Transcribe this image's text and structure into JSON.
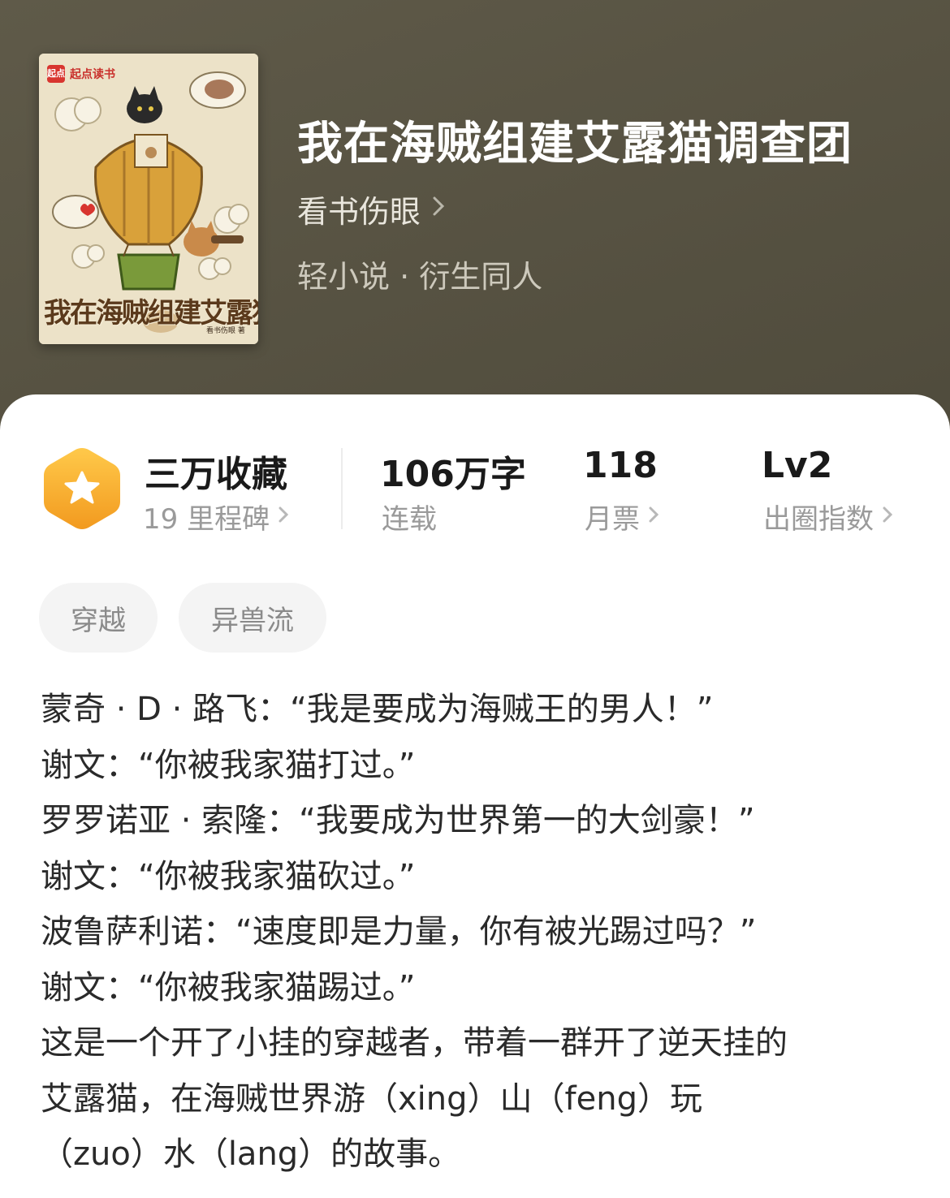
{
  "book": {
    "title": "我在海贼组建艾露猫调查团",
    "author": "看书伤眼",
    "category": "轻小说 · 衍生同人"
  },
  "cover": {
    "brand": "起点读书",
    "logo_text": "起点",
    "title": "我在海贼组建艾露猫调查团",
    "author_credit": "看书伤眼 著"
  },
  "stats": {
    "collections": {
      "value": "三万收藏",
      "label": "19 里程碑"
    },
    "words": {
      "value": "106万字",
      "label": "连载"
    },
    "monthly_tickets": {
      "value": "118",
      "label": "月票"
    },
    "popularity": {
      "value": "Lv2",
      "label": "出圈指数"
    }
  },
  "tags": [
    "穿越",
    "异兽流"
  ],
  "description": [
    "蒙奇 · D · 路飞：“我是要成为海贼王的男人！”",
    "谢文：“你被我家猫打过。”",
    "罗罗诺亚 · 索隆：“我要成为世界第一的大剑豪！”",
    "谢文：“你被我家猫砍过。”",
    "波鲁萨利诺：“速度即是力量，你有被光踢过吗？”",
    "谢文：“你被我家猫踢过。”",
    "这是一个开了小挂的穿越者，带着一群开了逆天挂的",
    "艾露猫，在海贼世界游（xing）山（feng）玩",
    "（zuo）水（lang）的故事。"
  ],
  "icons": {
    "badge": "star-hexagon-icon",
    "chevron": "chevron-right-icon"
  },
  "colors": {
    "header_bg": "#55503f",
    "badge_gradient_top": "#ffc94a",
    "badge_gradient_bottom": "#f29a1f",
    "tag_bg": "#f4f4f4"
  }
}
